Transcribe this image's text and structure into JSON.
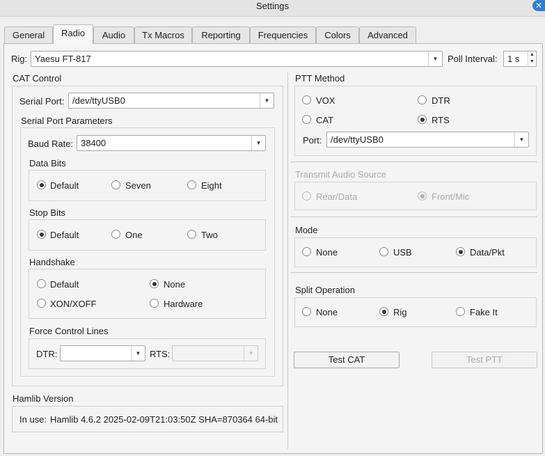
{
  "window": {
    "title": "Settings"
  },
  "tabs": [
    "General",
    "Radio",
    "Audio",
    "Tx Macros",
    "Reporting",
    "Frequencies",
    "Colors",
    "Advanced"
  ],
  "rig": {
    "label": "Rig:",
    "value": "Yaesu FT-817",
    "poll_label": "Poll Interval:",
    "poll_value": "1 s"
  },
  "cat": {
    "title": "CAT Control",
    "serial_port_label": "Serial Port:",
    "serial_port_value": "/dev/ttyUSB0",
    "params_title": "Serial Port Parameters",
    "baud_label": "Baud Rate:",
    "baud_value": "38400",
    "data_bits": {
      "title": "Data Bits",
      "options": [
        "Default",
        "Seven",
        "Eight"
      ],
      "selected": "Default"
    },
    "stop_bits": {
      "title": "Stop Bits",
      "options": [
        "Default",
        "One",
        "Two"
      ],
      "selected": "Default"
    },
    "handshake": {
      "title": "Handshake",
      "options": [
        "Default",
        "None",
        "XON/XOFF",
        "Hardware"
      ],
      "selected": "None"
    },
    "force": {
      "title": "Force Control Lines",
      "dtr_label": "DTR:",
      "rts_label": "RTS:",
      "dtr_value": "",
      "rts_value": ""
    }
  },
  "ptt": {
    "title": "PTT Method",
    "options": [
      "VOX",
      "DTR",
      "CAT",
      "RTS"
    ],
    "selected": "RTS",
    "port_label": "Port:",
    "port_value": "/dev/ttyUSB0"
  },
  "tx_audio": {
    "title": "Transmit Audio Source",
    "options": [
      "Rear/Data",
      "Front/Mic"
    ],
    "selected": "Front/Mic"
  },
  "mode": {
    "title": "Mode",
    "options": [
      "None",
      "USB",
      "Data/Pkt"
    ],
    "selected": "Data/Pkt"
  },
  "split": {
    "title": "Split Operation",
    "options": [
      "None",
      "Rig",
      "Fake It"
    ],
    "selected": "Rig"
  },
  "buttons": {
    "test_cat": "Test CAT",
    "test_ptt": "Test PTT"
  },
  "hamlib": {
    "title": "Hamlib Version",
    "in_use_label": "In use:",
    "version": "Hamlib 4.6.2 2025-02-09T21:03:50Z SHA=870364 64-bit"
  }
}
